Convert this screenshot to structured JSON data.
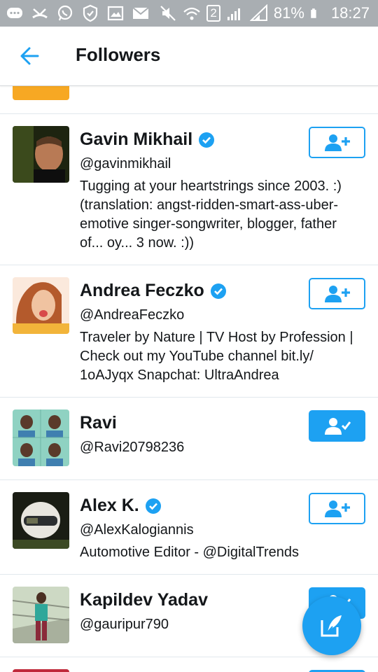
{
  "status_bar": {
    "sim_number": "2",
    "battery_percent": "81%",
    "time": "18:27",
    "icons": [
      "chat-icon",
      "missed-call-icon",
      "whatsapp-icon",
      "shield-icon",
      "gallery-icon",
      "mail-icon",
      "mute-icon",
      "wifi-icon",
      "signal-icon",
      "battery-icon"
    ]
  },
  "header": {
    "back_icon": "arrow-left-icon",
    "title": "Followers"
  },
  "colors": {
    "accent": "#1da1f2",
    "verified": "#1da1f2",
    "status_bar": "#a9aeb2"
  },
  "followers": [
    {
      "name": "Gavin Mikhail",
      "verified": true,
      "handle": "@gavinmikhail",
      "bio_lines": [
        "Tugging at your heartstrings since 2003. :)",
        "(translation: angst-ridden-smart-ass-uber-",
        "emotive singer-songwriter, blogger, father",
        "of... oy... 3 now. :))"
      ],
      "following": false
    },
    {
      "name": "Andrea Feczko",
      "verified": true,
      "handle": "@AndreaFeczko",
      "bio_lines": [
        "Traveler by Nature | TV Host by Profession |",
        "Check out my YouTube channel bit.ly/",
        "1oAJyqx Snapchat: UltraAndrea"
      ],
      "following": false
    },
    {
      "name": "Ravi",
      "verified": false,
      "handle": "@Ravi20798236",
      "bio_lines": [],
      "following": true
    },
    {
      "name": "Alex K.",
      "verified": true,
      "handle": "@AlexKalogiannis",
      "bio_lines": [
        "Automotive Editor - @DigitalTrends"
      ],
      "following": false
    },
    {
      "name": "Kapildev Yadav",
      "verified": false,
      "handle": "@gauripur790",
      "bio_lines": [],
      "following": true
    }
  ],
  "fab": {
    "icon": "compose-tweet-icon"
  }
}
